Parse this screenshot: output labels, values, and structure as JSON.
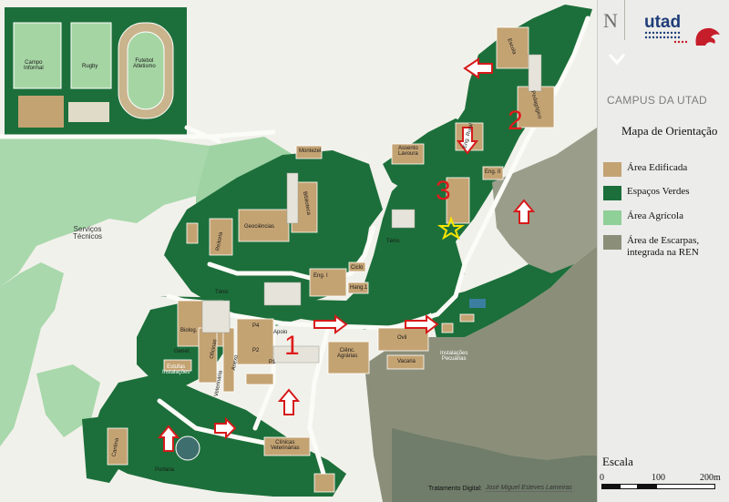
{
  "panel": {
    "north": "N",
    "logo": "utad",
    "campus_title": "CAMPUS DA UTAD",
    "map_title": "Mapa de Orientação",
    "legend": [
      {
        "label": "Área Edificada",
        "color": "#c4a373"
      },
      {
        "label": "Espaços Verdes",
        "color": "#1c6f3a"
      },
      {
        "label": "Área Agrícola",
        "color": "#8fcf98"
      },
      {
        "label": "Área de Escarpas, integrada na REN",
        "color": "#8b8f7a"
      }
    ],
    "scale_title": "Escala",
    "scale_ticks": [
      "0",
      "100",
      "200m"
    ]
  },
  "credit": {
    "label": "Tratamento Digital:",
    "name": "José Miguel Esteves Lameiras"
  },
  "map": {
    "numbers": [
      "1",
      "2",
      "3"
    ],
    "buildings": {
      "campo_informal": "Campo\nInformal",
      "rugby": "Rugby",
      "futebol": "Futebol\nAtletismo",
      "servicos": "Serviços\nTécnicos",
      "reitoria": "Reitoria",
      "geociencias": "Geociências",
      "biblioteca": "Biblioteca",
      "eng1": "Eng. I",
      "hang1": "Hang.1",
      "tenis": "Ténis",
      "ciclo": "Ciclo",
      "biolog": "Biolog.",
      "genet": "Genet.",
      "oficinas": "Oficinas",
      "veterinaria": "Veterinária",
      "cantina": "Cantina",
      "clinicas": "Clínicas\nVeterinárias",
      "agrarias": "Ciênc.\nAgrárias",
      "ovil": "Ovil",
      "vacaria": "Vacaria",
      "pecuarias": "Instalações\nPecuárias",
      "assento": "Assento\nLavoura",
      "engrurt": "Eng. Rural",
      "eng2": "Eng. II",
      "pedagogico": "Pedagógico",
      "escola": "Escola",
      "tenis2": "Ténis",
      "monteiro": "Montezel",
      "porta": "Portaria",
      "p4": "P4",
      "p2": "P2",
      "p1": "P1",
      "ap": "Apoio",
      "anex": "Anexo",
      "estufas": "Estufas\nInstalações"
    }
  }
}
